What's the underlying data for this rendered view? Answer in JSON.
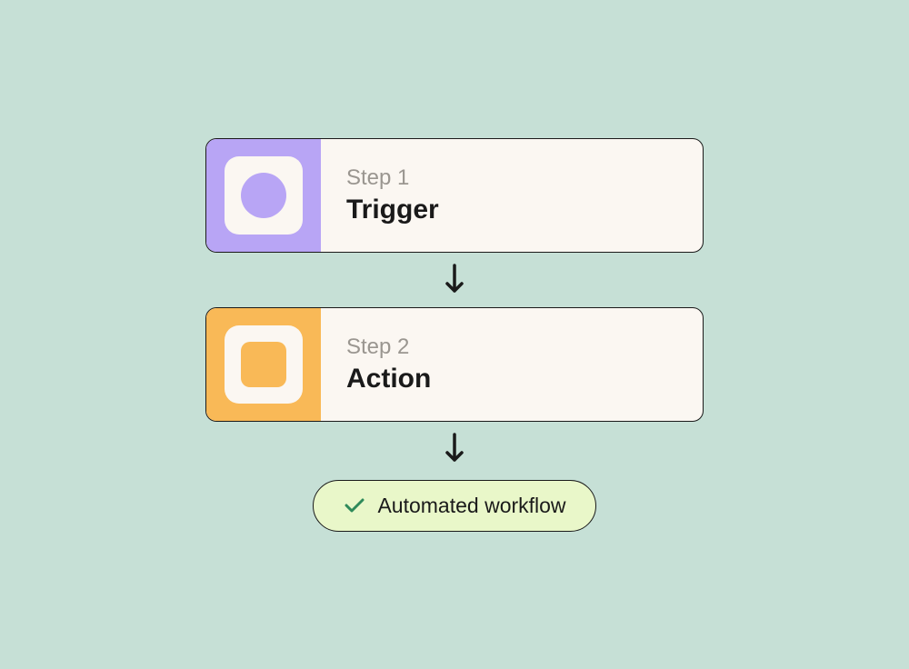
{
  "steps": [
    {
      "label": "Step 1",
      "title": "Trigger",
      "iconShape": "circle",
      "color": "purple"
    },
    {
      "label": "Step 2",
      "title": "Action",
      "iconShape": "square",
      "color": "orange"
    }
  ],
  "result": {
    "label": "Automated workflow"
  }
}
